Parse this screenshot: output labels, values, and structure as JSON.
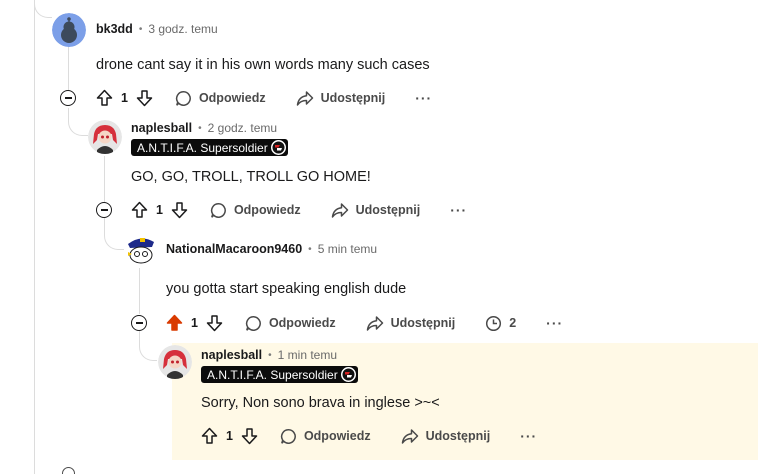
{
  "comments": [
    {
      "author": "bk3dd",
      "time": "3 godz. temu",
      "text": "drone cant say it in his own words many such cases",
      "votes": "1"
    },
    {
      "author": "naplesball",
      "time": "2 godz. temu",
      "flair": "A.N.T.I.F.A. Supersoldier",
      "text": "GO, GO, TROLL, TROLL GO HOME!",
      "votes": "1"
    },
    {
      "author": "NationalMacaroon9460",
      "time": "5 min temu",
      "text": "you gotta start speaking english dude",
      "votes": "1",
      "awards": "2"
    },
    {
      "author": "naplesball",
      "time": "1 min temu",
      "flair": "A.N.T.I.F.A. Supersoldier",
      "text": "Sorry, Non sono brava in inglese >~<",
      "votes": "1"
    }
  ],
  "labels": {
    "reply": "Odpowiedz",
    "share": "Udostępnij",
    "more": "···",
    "separator": "•"
  },
  "icons": {
    "upvote": "upvote-icon",
    "downvote": "downvote-icon",
    "reply": "comment-bubble-icon",
    "share": "share-arrow-icon",
    "award": "timer-award-icon",
    "more": "more-dots-icon",
    "collapse": "collapse-minus-icon"
  },
  "colors": {
    "upvoted": "#d93a00",
    "highlight_bg": "#fff9e6",
    "flair_bg": "#0b0b0b"
  }
}
